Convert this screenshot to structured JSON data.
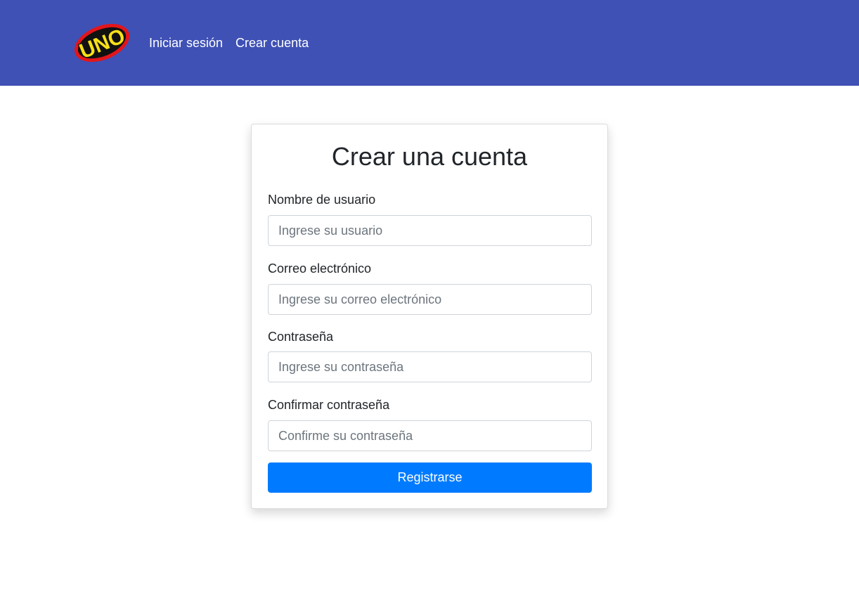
{
  "navbar": {
    "logo_text": "UNO",
    "links": [
      {
        "label": "Iniciar sesión"
      },
      {
        "label": "Crear cuenta"
      }
    ],
    "background_color": "#3f51b5"
  },
  "form": {
    "title": "Crear una cuenta",
    "fields": [
      {
        "label": "Nombre de usuario",
        "placeholder": "Ingrese su usuario",
        "value": ""
      },
      {
        "label": "Correo electrónico",
        "placeholder": "Ingrese su correo electrónico",
        "value": ""
      },
      {
        "label": "Contraseña",
        "placeholder": "Ingrese su contraseña",
        "value": ""
      },
      {
        "label": "Confirmar contraseña",
        "placeholder": "Confirme su contraseña",
        "value": ""
      }
    ],
    "submit_label": "Registrarse",
    "submit_color": "#007bff"
  }
}
